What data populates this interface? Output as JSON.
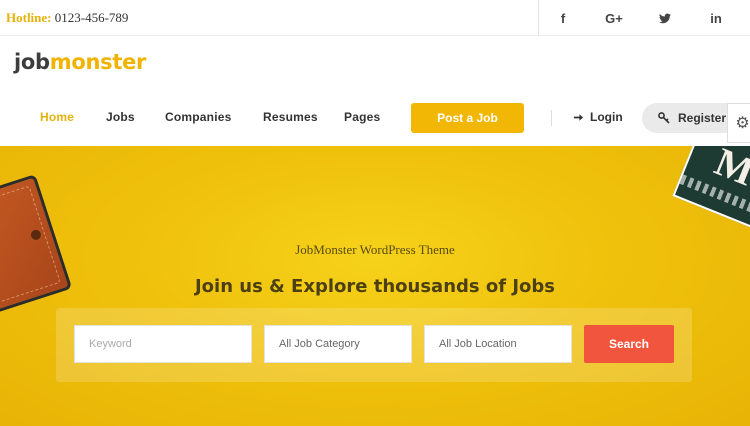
{
  "topbar": {
    "hotline_label": "Hotline:",
    "hotline_number": "0123-456-789",
    "social": [
      {
        "icon": "facebook-icon",
        "glyph": "f"
      },
      {
        "icon": "google-plus-icon",
        "glyph": "G+"
      },
      {
        "icon": "twitter-icon",
        "glyph": "🐦"
      },
      {
        "icon": "linkedin-icon",
        "glyph": "in"
      }
    ]
  },
  "logo": {
    "part1": "job",
    "part2": "monster"
  },
  "nav": {
    "items": [
      "Home",
      "Jobs",
      "Companies",
      "Resumes",
      "Pages"
    ],
    "active": "Home",
    "post_job": "Post a Job",
    "login": "Login",
    "register": "Register"
  },
  "hero": {
    "subtitle": "JobMonster WordPress Theme",
    "headline": "Join us & Explore thousands of Jobs",
    "magazine_letter": "M"
  },
  "search": {
    "keyword_placeholder": "Keyword",
    "category_value": "All Job Category",
    "location_value": "All Job Location",
    "button": "Search"
  },
  "colors": {
    "accent": "#f2b705",
    "search_button": "#f1553d",
    "hero_bg": "#efc10c"
  }
}
